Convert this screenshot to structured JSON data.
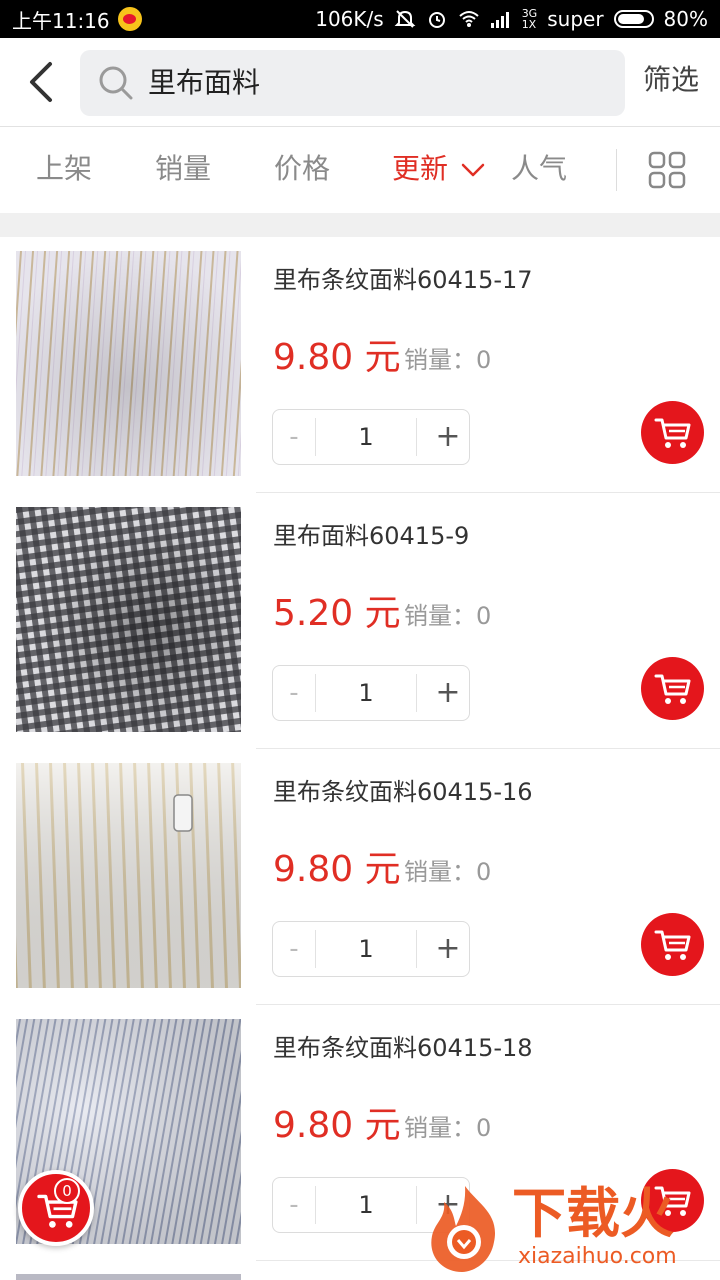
{
  "status_bar": {
    "time": "上午11:16",
    "speed": "106K/s",
    "network": "3G",
    "sim_sub": "1X",
    "carrier": "super",
    "battery": "80%",
    "battery_level": 0.8
  },
  "header": {
    "search_text": "里布面料",
    "filter_label": "筛选"
  },
  "sort_tabs": [
    {
      "label": "上架"
    },
    {
      "label": "销量"
    },
    {
      "label": "价格"
    },
    {
      "label": "更新"
    },
    {
      "label": "人气"
    }
  ],
  "sort_active": "更新",
  "products": [
    {
      "title": "里布条纹面料60415-17",
      "price": "9.80 元",
      "sales": "销量：0",
      "qty": "1",
      "thumb": "stripe-beige"
    },
    {
      "title": "里布面料60415-9",
      "price": "5.20 元",
      "sales": "销量：0",
      "qty": "1",
      "thumb": "gingham-black"
    },
    {
      "title": "里布条纹面料60415-16",
      "price": "9.80 元",
      "sales": "销量：0",
      "qty": "1",
      "thumb": "stripe-tan"
    },
    {
      "title": "里布条纹面料60415-18",
      "price": "9.80 元",
      "sales": "销量：0",
      "qty": "1",
      "thumb": "stripe-blue"
    }
  ],
  "stepper": {
    "minus": "-",
    "plus": "+"
  },
  "floating_cart": {
    "count": "0"
  },
  "watermark": {
    "cn": "下载火",
    "en": "xiazaihuo.com"
  },
  "colors": {
    "accent": "#e02e24",
    "cart": "#e4161c",
    "watermark": "#ec5b24"
  },
  "icons": [
    "back-arrow-icon",
    "search-icon",
    "chevron-down-icon",
    "grid-view-icon",
    "shopping-cart-icon"
  ]
}
